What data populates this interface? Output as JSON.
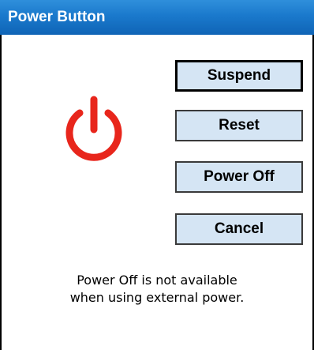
{
  "window": {
    "title": "Power Button"
  },
  "buttons": {
    "suspend": "Suspend",
    "reset": "Reset",
    "power_off": "Power Off",
    "cancel": "Cancel"
  },
  "message": {
    "line1": "Power Off is not available",
    "line2": "when using external power."
  },
  "icon": {
    "name": "power-icon",
    "color": "#e8261c"
  },
  "colors": {
    "titlebar": "#1a79cc",
    "button_fill": "#d5e5f4"
  }
}
